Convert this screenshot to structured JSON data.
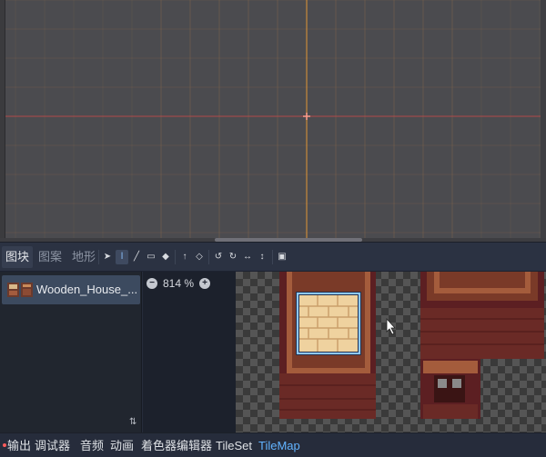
{
  "panel": {
    "tabs": [
      {
        "label": "图块",
        "active": true
      },
      {
        "label": "图案",
        "active": false
      },
      {
        "label": "地形",
        "active": false
      }
    ],
    "tools": [
      "select-icon",
      "paint-icon",
      "line-icon",
      "rect-icon",
      "bucket-icon",
      "picker-icon",
      "eraser-icon",
      "rotate-left-icon",
      "rotate-right-icon",
      "flip-h-icon",
      "flip-v-icon",
      "random-icon"
    ],
    "source_list": [
      {
        "label": "Wooden_House_...",
        "selected": true
      }
    ],
    "zoom": {
      "value": "814 %"
    }
  },
  "statusbar": {
    "tabs": [
      {
        "label": "输出"
      },
      {
        "label": "调试器"
      },
      {
        "label": "音频"
      },
      {
        "label": "动画"
      },
      {
        "label": "着色器编辑器"
      },
      {
        "label": "TileSet"
      },
      {
        "label": "TileMap",
        "active": true
      }
    ]
  },
  "colors": {
    "accent": "#62b3ff",
    "viewport_bg": "#4b4b4f",
    "grid_line": "#8a6a4a",
    "axis_x": "#b04a4a",
    "axis_y": "#c98a3a",
    "selection": "#8ec8ff",
    "error_dot": "#ff5c5c"
  }
}
